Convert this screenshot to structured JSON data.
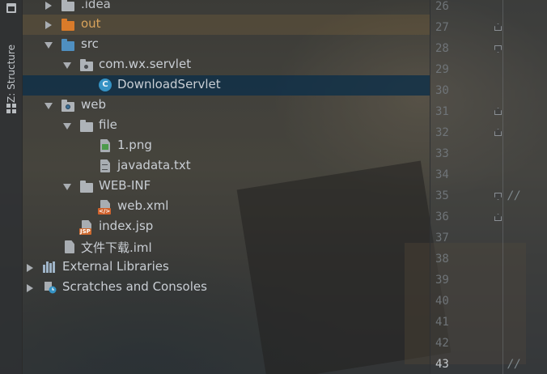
{
  "tool_window": {
    "structure_label": "Z: Structure"
  },
  "tree": {
    "items": [
      {
        "label": ".idea"
      },
      {
        "label": "out"
      },
      {
        "label": "src"
      },
      {
        "label": "com.wx.servlet"
      },
      {
        "label": "DownloadServlet",
        "icon_text": "C"
      },
      {
        "label": "web"
      },
      {
        "label": "file"
      },
      {
        "label": "1.png"
      },
      {
        "label": "javadata.txt"
      },
      {
        "label": "WEB-INF"
      },
      {
        "label": "web.xml",
        "badge": "</>"
      },
      {
        "label": "index.jsp",
        "badge": "JSP"
      },
      {
        "label": "文件下载.iml"
      },
      {
        "label": "External Libraries"
      },
      {
        "label": "Scratches and Consoles"
      }
    ]
  },
  "gutter": {
    "line_numbers": [
      "26",
      "27",
      "28",
      "29",
      "30",
      "31",
      "32",
      "33",
      "34",
      "35",
      "36",
      "37",
      "38",
      "39",
      "40",
      "41",
      "42",
      "43"
    ],
    "current_line": "43",
    "comments": {
      "line35": "//",
      "line43": "//"
    }
  },
  "colors": {
    "selection": "#0f3048",
    "excluded_folder": "#d97b2a",
    "source_folder": "#4f8fc0",
    "class_icon": "#3592c4"
  }
}
